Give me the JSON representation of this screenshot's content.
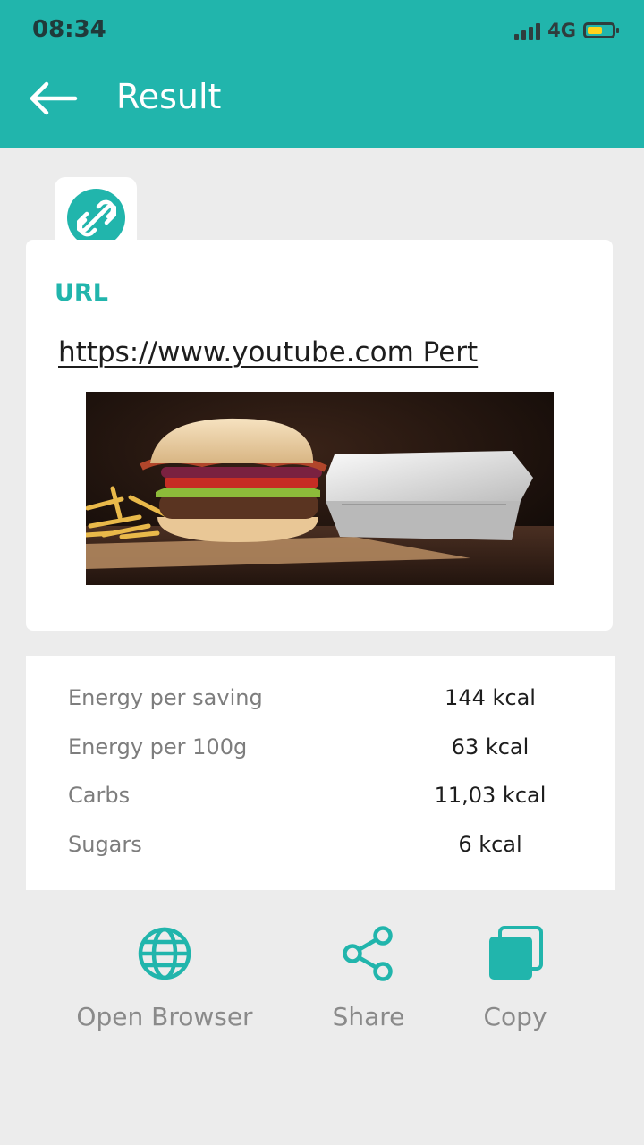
{
  "status_bar": {
    "time": "08:34",
    "network": "4G",
    "signal_icon": "signal-bars-icon",
    "battery_icon": "battery-icon",
    "battery_level": 0.6
  },
  "app_bar": {
    "title": "Result",
    "back_icon": "arrow-left-icon",
    "color": "#21b5ac"
  },
  "result": {
    "type_icon": "link-icon",
    "type_label": "URL",
    "url_text": "https://www.youtube.com Pert",
    "image": "burger-photo"
  },
  "nutrition": [
    {
      "label": "Energy per saving",
      "value": "144 kcal"
    },
    {
      "label": "Energy per 100g",
      "value": "63 kcal"
    },
    {
      "label": "Carbs",
      "value": "11,03 kcal"
    },
    {
      "label": "Sugars",
      "value": "6 kcal"
    }
  ],
  "actions": {
    "open_browser": {
      "label": "Open Browser",
      "icon": "globe-icon"
    },
    "share": {
      "label": "Share",
      "icon": "share-icon"
    },
    "copy": {
      "label": "Copy",
      "icon": "copy-icon"
    }
  },
  "colors": {
    "accent": "#21b5ac",
    "background": "#ececec",
    "card": "#ffffff"
  }
}
